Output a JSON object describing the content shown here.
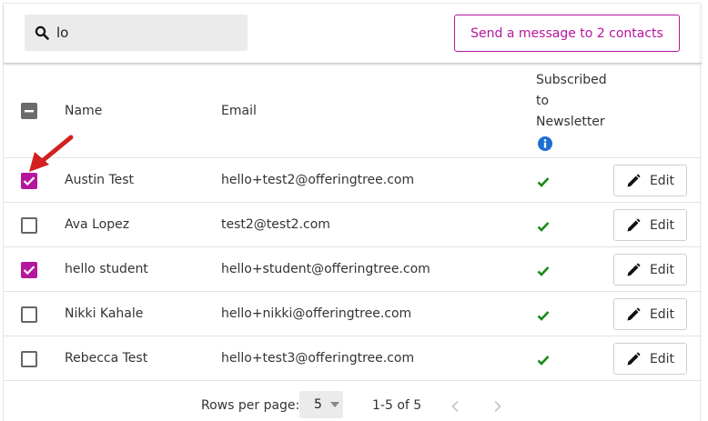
{
  "search": {
    "value": "lo",
    "icon": "search-icon"
  },
  "toolbar": {
    "send_label": "Send a message to 2 contacts"
  },
  "table": {
    "headers": {
      "name": "Name",
      "email": "Email",
      "subscribed_line1": "Subscribed",
      "subscribed_line2": "to",
      "subscribed_line3": "Newsletter"
    },
    "edit_label": "Edit",
    "rows": [
      {
        "name": "Austin Test",
        "email": "hello+test2@offeringtree.com",
        "checked": true
      },
      {
        "name": "Ava Lopez",
        "email": "test2@test2.com",
        "checked": false
      },
      {
        "name": "hello student",
        "email": "hello+student@offeringtree.com",
        "checked": true
      },
      {
        "name": "Nikki Kahale",
        "email": "hello+nikki@offeringtree.com",
        "checked": false
      },
      {
        "name": "Rebecca Test",
        "email": "hello+test3@offeringtree.com",
        "checked": false
      }
    ]
  },
  "pagination": {
    "rows_per_page_label": "Rows per page:",
    "rows_per_page_value": "5",
    "range": "1-5 of 5"
  },
  "colors": {
    "accent": "#b5169e",
    "check_green": "#1a8a1a",
    "info_blue": "#1b6fd1"
  }
}
